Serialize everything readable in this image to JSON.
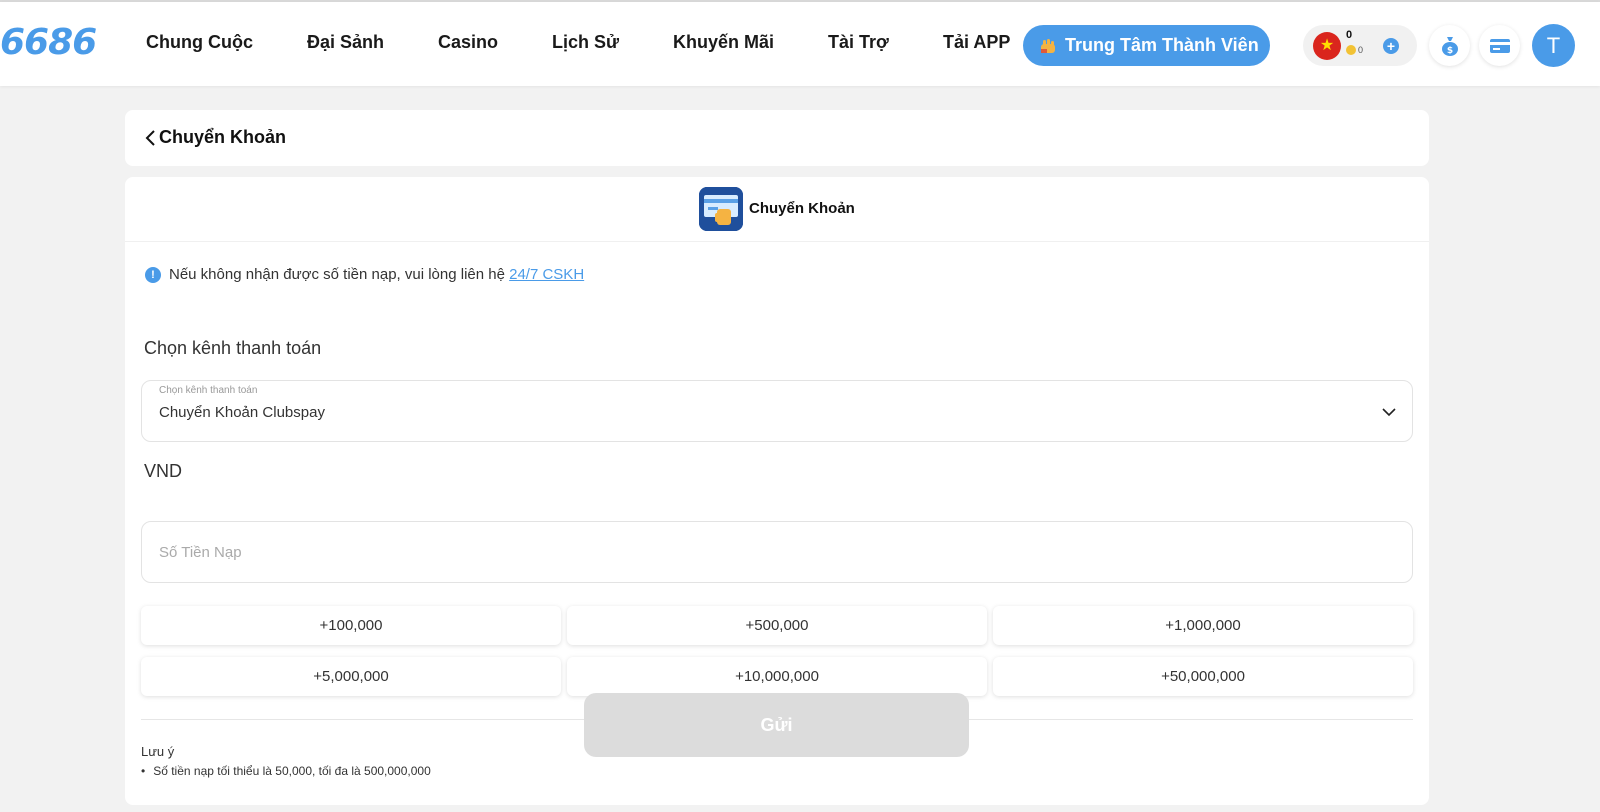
{
  "header": {
    "logo": "6686",
    "nav": [
      "Chung Cuộc",
      "Đại Sảnh",
      "Casino",
      "Lịch Sử",
      "Khuyến Mãi",
      "Tài Trợ",
      "Tải APP"
    ],
    "member_center": "Trung Tâm Thành Viên",
    "wallet": {
      "balance": "0",
      "coin_balance": "0",
      "flag_icon": "vietnam-flag-icon"
    },
    "avatar_letter": "T"
  },
  "page": {
    "title": "Chuyển Khoản"
  },
  "method": {
    "label": "Chuyển Khoản"
  },
  "form": {
    "notice_text": "Nếu không nhận được số tiền nạp, vui lòng liên hệ ",
    "notice_link": "24/7 CSKH",
    "channel_section": "Chọn kênh thanh toán",
    "channel_caption": "Chọn kênh thanh toán",
    "channel_value": "Chuyển Khoản Clubspay",
    "currency": "VND",
    "amount_placeholder": "Số Tiền Nạp",
    "quick_amounts": [
      "+100,000",
      "+500,000",
      "+1,000,000",
      "+5,000,000",
      "+10,000,000",
      "+50,000,000"
    ],
    "submit": "Gửi",
    "note_title": "Lưu ý",
    "note_items": [
      "Số tiền nạp tối thiểu là 50,000, tối đa là 500,000,000"
    ]
  },
  "colors": {
    "accent": "#4a9be8",
    "background": "#f2f2f2",
    "submit_disabled": "#dcdcdc"
  }
}
